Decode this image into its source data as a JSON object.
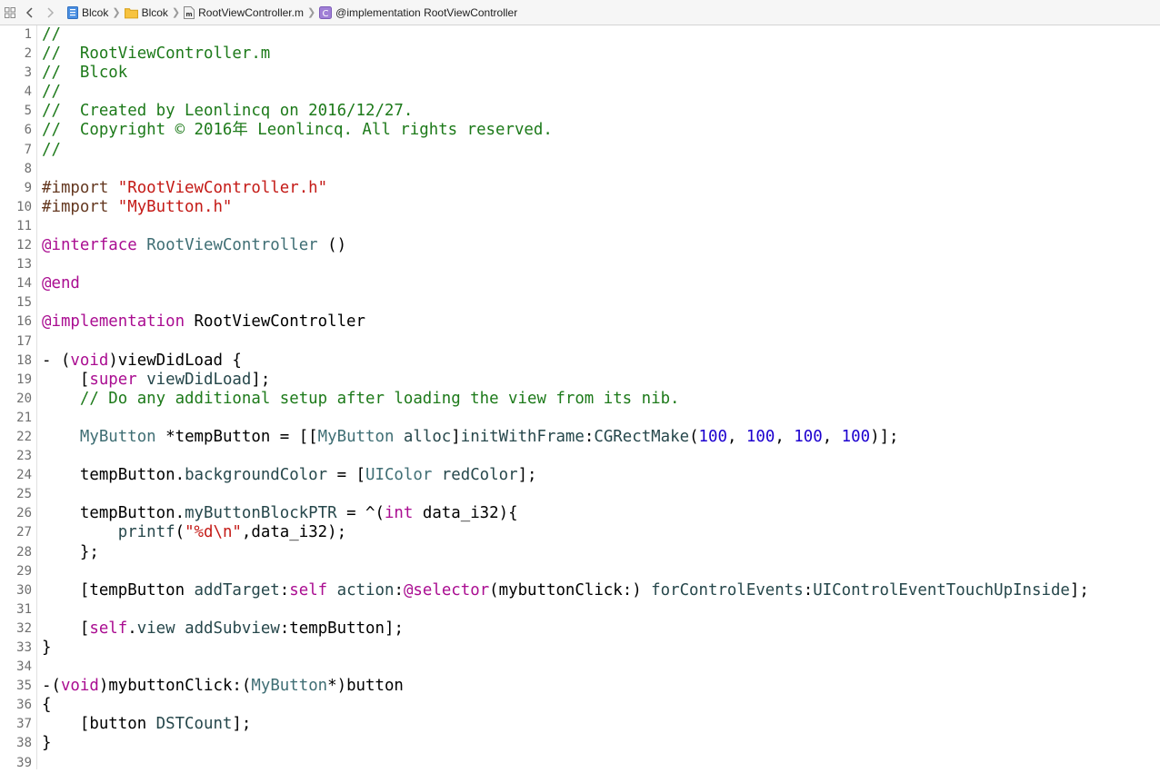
{
  "jump_bar": {
    "back_label": "<",
    "forward_label": ">",
    "crumbs": [
      {
        "label": "Blcok",
        "icon": "project-icon"
      },
      {
        "label": "Blcok",
        "icon": "folder-icon"
      },
      {
        "label": "RootViewController.m",
        "icon": "objc-m-file-icon"
      },
      {
        "label": "@implementation RootViewController",
        "icon": "class-c-icon"
      }
    ]
  },
  "colors": {
    "comment": "#1d7a1a",
    "string": "#c41a16",
    "preprocessor": "#643820",
    "keyword": "#aa0d91",
    "class": "#3f6e74",
    "method": "#26474b",
    "number": "#1c00cf"
  },
  "editor": {
    "lines": [
      [
        [
          "c",
          "//"
        ]
      ],
      [
        [
          "c",
          "//  RootViewController.m"
        ]
      ],
      [
        [
          "c",
          "//  Blcok"
        ]
      ],
      [
        [
          "c",
          "//"
        ]
      ],
      [
        [
          "c",
          "//  Created by Leonlincq on 2016/12/27."
        ]
      ],
      [
        [
          "c",
          "//  Copyright © 2016年 Leonlincq. All rights reserved."
        ]
      ],
      [
        [
          "c",
          "//"
        ]
      ],
      [],
      [
        [
          "pp",
          "#import "
        ],
        [
          "s",
          "\"RootViewController.h\""
        ]
      ],
      [
        [
          "pp",
          "#import "
        ],
        [
          "s",
          "\"MyButton.h\""
        ]
      ],
      [],
      [
        [
          "k",
          "@interface"
        ],
        [
          "p",
          " "
        ],
        [
          "t",
          "RootViewController"
        ],
        [
          "p",
          " ()"
        ]
      ],
      [],
      [
        [
          "k",
          "@end"
        ]
      ],
      [],
      [
        [
          "k",
          "@implementation"
        ],
        [
          "p",
          " RootViewController"
        ]
      ],
      [],
      [
        [
          "p",
          "- ("
        ],
        [
          "k",
          "void"
        ],
        [
          "p",
          ")viewDidLoad {"
        ]
      ],
      [
        [
          "p",
          "    ["
        ],
        [
          "k",
          "super"
        ],
        [
          "p",
          " "
        ],
        [
          "m",
          "viewDidLoad"
        ],
        [
          "p",
          "];"
        ]
      ],
      [
        [
          "p",
          "    "
        ],
        [
          "c",
          "// Do any additional setup after loading the view from its nib."
        ]
      ],
      [],
      [
        [
          "p",
          "    "
        ],
        [
          "t",
          "MyButton"
        ],
        [
          "p",
          " *tempButton = [["
        ],
        [
          "t",
          "MyButton"
        ],
        [
          "p",
          " "
        ],
        [
          "m",
          "alloc"
        ],
        [
          "p",
          "]"
        ],
        [
          "m",
          "initWithFrame"
        ],
        [
          "p",
          ":"
        ],
        [
          "m",
          "CGRectMake"
        ],
        [
          "p",
          "("
        ],
        [
          "n",
          "100"
        ],
        [
          "p",
          ", "
        ],
        [
          "n",
          "100"
        ],
        [
          "p",
          ", "
        ],
        [
          "n",
          "100"
        ],
        [
          "p",
          ", "
        ],
        [
          "n",
          "100"
        ],
        [
          "p",
          ")];"
        ]
      ],
      [],
      [
        [
          "p",
          "    tempButton."
        ],
        [
          "m",
          "backgroundColor"
        ],
        [
          "p",
          " = ["
        ],
        [
          "t",
          "UIColor"
        ],
        [
          "p",
          " "
        ],
        [
          "m",
          "redColor"
        ],
        [
          "p",
          "];"
        ]
      ],
      [],
      [
        [
          "p",
          "    tempButton."
        ],
        [
          "m",
          "myButtonBlockPTR"
        ],
        [
          "p",
          " = ^("
        ],
        [
          "k",
          "int"
        ],
        [
          "p",
          " data_i32){"
        ]
      ],
      [
        [
          "p",
          "        "
        ],
        [
          "m",
          "printf"
        ],
        [
          "p",
          "("
        ],
        [
          "s",
          "\"%d\\n\""
        ],
        [
          "p",
          ",data_i32);"
        ]
      ],
      [
        [
          "p",
          "    };"
        ]
      ],
      [],
      [
        [
          "p",
          "    [tempButton "
        ],
        [
          "m",
          "addTarget"
        ],
        [
          "p",
          ":"
        ],
        [
          "k",
          "self"
        ],
        [
          "p",
          " "
        ],
        [
          "m",
          "action"
        ],
        [
          "p",
          ":"
        ],
        [
          "k",
          "@selector"
        ],
        [
          "p",
          "(mybuttonClick:) "
        ],
        [
          "m",
          "forControlEvents"
        ],
        [
          "p",
          ":"
        ],
        [
          "m",
          "UIControlEventTouchUpInside"
        ],
        [
          "p",
          "];"
        ]
      ],
      [],
      [
        [
          "p",
          "    ["
        ],
        [
          "k",
          "self"
        ],
        [
          "p",
          "."
        ],
        [
          "m",
          "view"
        ],
        [
          "p",
          " "
        ],
        [
          "m",
          "addSubview"
        ],
        [
          "p",
          ":tempButton];"
        ]
      ],
      [
        [
          "p",
          "}"
        ]
      ],
      [],
      [
        [
          "p",
          "-("
        ],
        [
          "k",
          "void"
        ],
        [
          "p",
          ")mybuttonClick:("
        ],
        [
          "t",
          "MyButton"
        ],
        [
          "p",
          "*)button"
        ]
      ],
      [
        [
          "p",
          "{"
        ]
      ],
      [
        [
          "p",
          "    [button "
        ],
        [
          "m",
          "DSTCount"
        ],
        [
          "p",
          "];"
        ]
      ],
      [
        [
          "p",
          "}"
        ]
      ],
      []
    ]
  }
}
